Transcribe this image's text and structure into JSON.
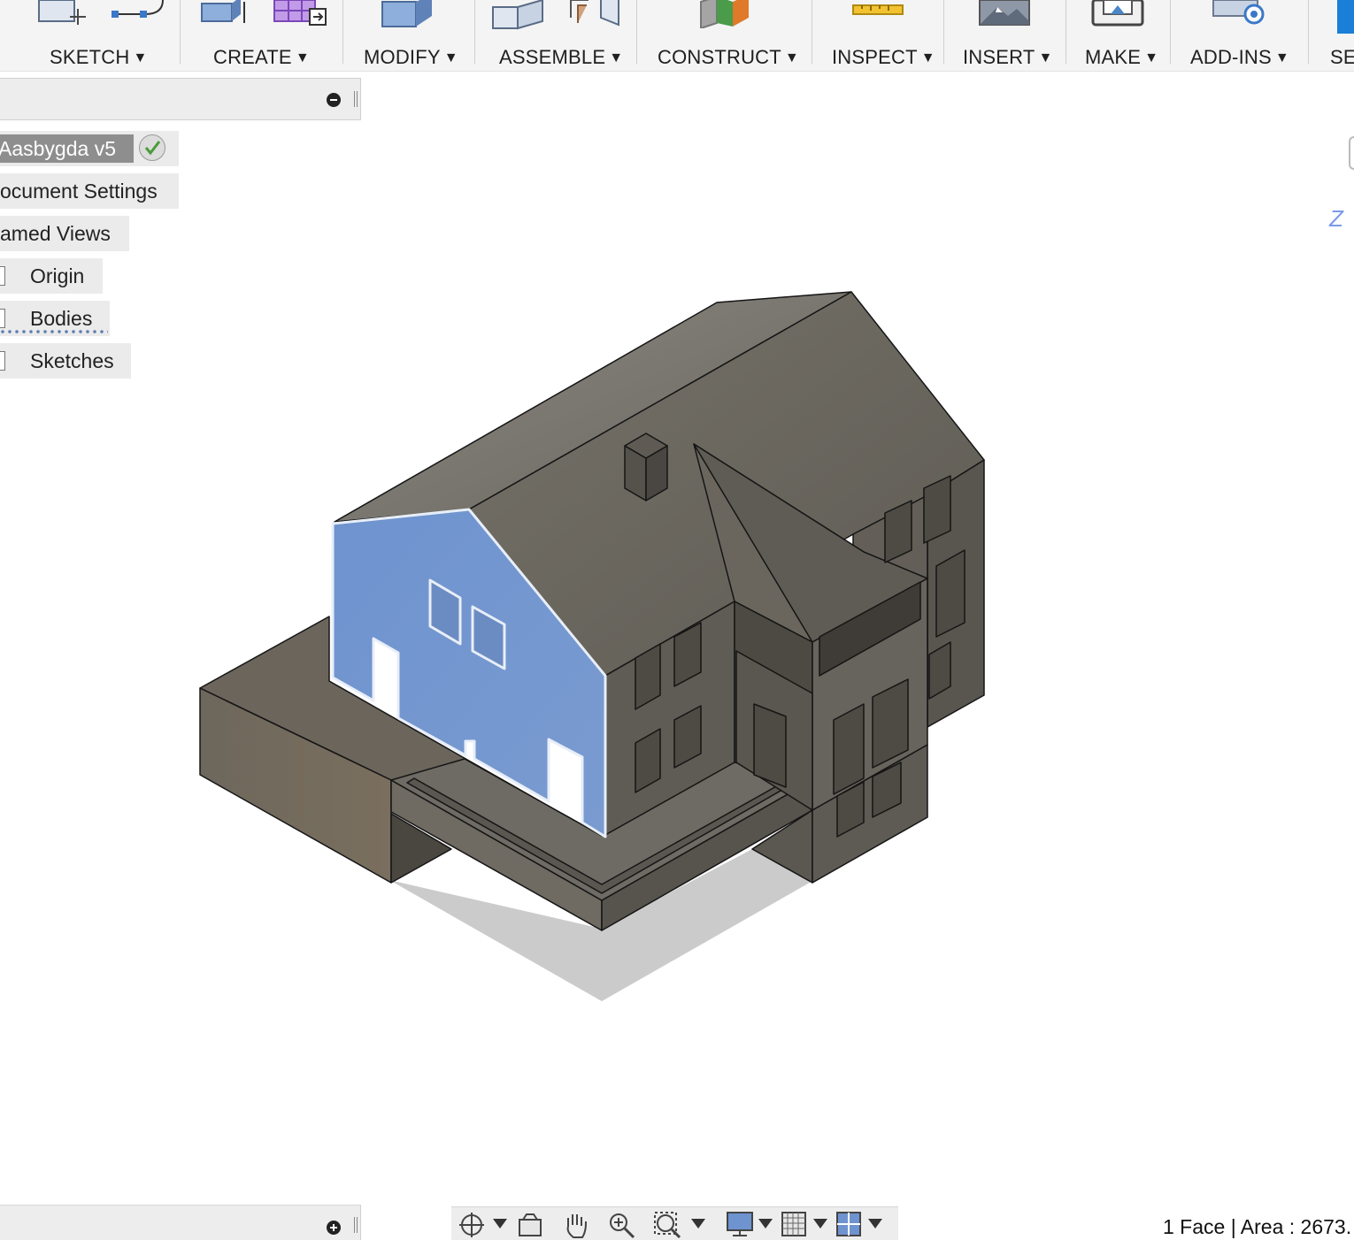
{
  "toolbar": {
    "groups": [
      {
        "label": "SKETCH"
      },
      {
        "label": "CREATE"
      },
      {
        "label": "MODIFY"
      },
      {
        "label": "ASSEMBLE"
      },
      {
        "label": "CONSTRUCT"
      },
      {
        "label": "INSPECT"
      },
      {
        "label": "INSERT"
      },
      {
        "label": "MAKE"
      },
      {
        "label": "ADD-INS"
      },
      {
        "label": "SE"
      }
    ],
    "caret": "▼"
  },
  "browser": {
    "root": "Aasbygda v5",
    "items": [
      {
        "label": "ocument Settings"
      },
      {
        "label": "amed Views"
      },
      {
        "label": "Origin"
      },
      {
        "label": "Bodies"
      },
      {
        "label": "Sketches"
      }
    ]
  },
  "viewcube": {
    "axis_label": "Z"
  },
  "status": {
    "text": "1 Face | Area : 2673."
  },
  "colors": {
    "selected_face": "#7096cc",
    "body": "#6f6c65",
    "toolbar_bg": "#f4f4f4",
    "panel_bg": "#ebebeb"
  }
}
